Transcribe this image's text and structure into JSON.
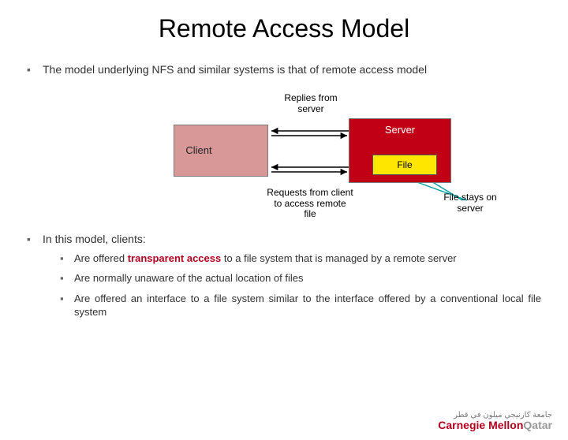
{
  "title": "Remote Access Model",
  "bullets": {
    "intro": "The model underlying NFS and similar systems is that of remote access model",
    "model_header": "In this model, clients:",
    "sub1a": "Are offered ",
    "sub1b": "transparent access",
    "sub1c": " to a file system that is managed by a remote server",
    "sub2": "Are normally unaware of the actual location of files",
    "sub3": "Are offered an interface to a file system similar to the interface offered by a conventional local file system"
  },
  "diagram": {
    "client": "Client",
    "server": "Server",
    "file": "File",
    "replies": "Replies from server",
    "requests": "Requests from client to access remote file",
    "filestays": "File stays on server"
  },
  "branding": {
    "arabic": "جامعة كارنيجي ميلون في قطر",
    "cmu": "Carnegie Mellon",
    "qatar": "Qatar"
  }
}
